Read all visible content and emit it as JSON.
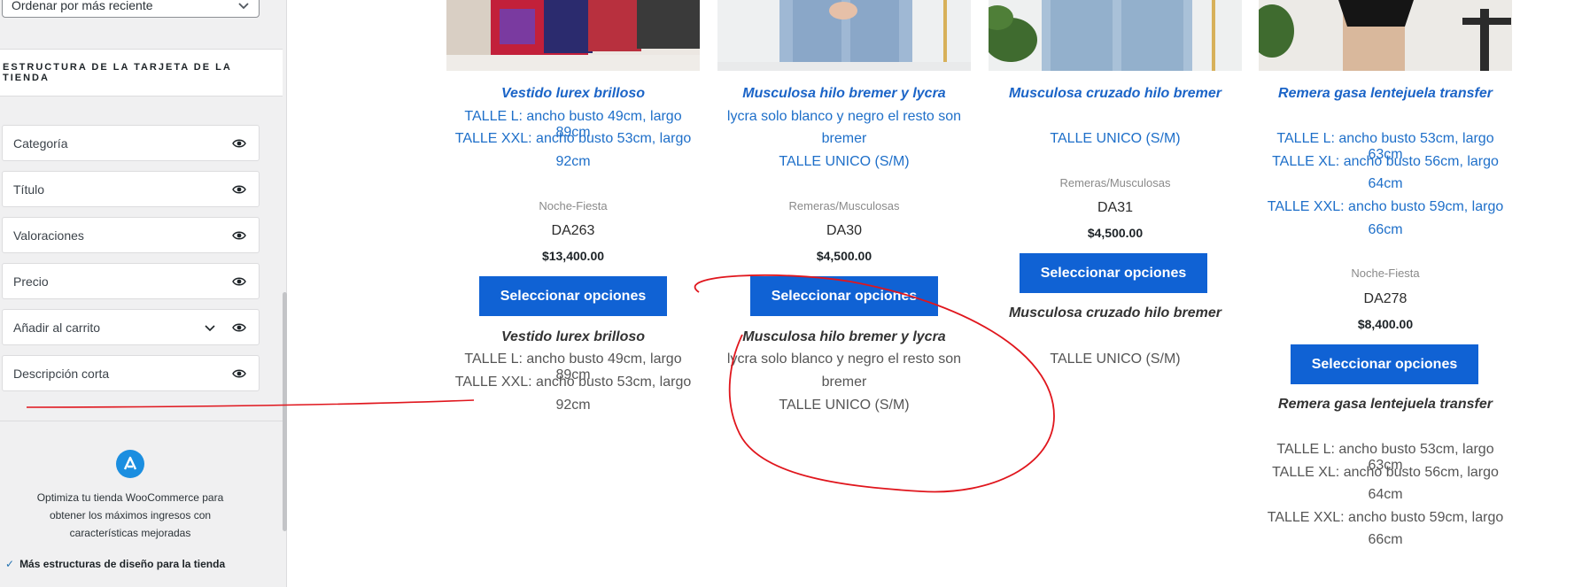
{
  "sidebar": {
    "sort_value": "Ordenar por más reciente",
    "section_title": "Estructura de la tarjeta de la tienda",
    "items": [
      {
        "label": "Categoría"
      },
      {
        "label": "Título"
      },
      {
        "label": "Valoraciones"
      },
      {
        "label": "Precio"
      },
      {
        "label": "Añadir al carrito"
      },
      {
        "label": "Descripción corta"
      }
    ],
    "promo_text": "Optimiza tu tienda WooCommerce para obtener los máximos ingresos con características mejoradas",
    "feature_text": "Más estructuras de diseño para la tienda"
  },
  "products": [
    {
      "title": "Vestido lurex brilloso",
      "desc1": "TALLE L: ancho busto 49cm, largo 89cm",
      "desc2": "TALLE XXL: ancho busto 53cm, largo",
      "desc3": "92cm",
      "category": "Noche-Fiesta",
      "sku": "DA263",
      "price": "$13,400.00",
      "button": "Seleccionar opciones",
      "title2": "Vestido lurex brilloso",
      "b1": "TALLE L: ancho busto 49cm, largo 89cm",
      "b2": "TALLE XXL: ancho busto 53cm, largo",
      "b3": "92cm"
    },
    {
      "title": "Musculosa hilo bremer y lycra",
      "desc1": "lycra solo blanco y negro el resto son",
      "desc2": "bremer",
      "desc3": "TALLE UNICO (S/M)",
      "category": "Remeras/Musculosas",
      "sku": "DA30",
      "price": "$4,500.00",
      "button": "Seleccionar opciones",
      "title2": "Musculosa hilo bremer y lycra",
      "b1": "lycra solo blanco y negro el resto son",
      "b2": "bremer",
      "b3": "TALLE UNICO (S/M)"
    },
    {
      "title": "Musculosa cruzado hilo bremer",
      "desc1": "TALLE UNICO (S/M)",
      "category": "Remeras/Musculosas",
      "sku": "DA31",
      "price": "$4,500.00",
      "button": "Seleccionar opciones",
      "title2": "Musculosa cruzado hilo bremer",
      "b1": "TALLE UNICO (S/M)"
    },
    {
      "title": "Remera gasa lentejuela transfer",
      "desc1": "TALLE L: ancho busto 53cm, largo 63cm",
      "desc2": "TALLE XL: ancho busto 56cm, largo",
      "desc3": "64cm",
      "desc4": "TALLE XXL: ancho busto 59cm, largo",
      "desc5": "66cm",
      "category": "Noche-Fiesta",
      "sku": "DA278",
      "price": "$8,400.00",
      "button": "Seleccionar opciones",
      "title2": "Remera gasa lentejuela transfer",
      "b1": "TALLE L: ancho busto 53cm, largo 63cm",
      "b2": "TALLE XL: ancho busto 56cm, largo",
      "b3": "64cm",
      "b4": "TALLE XXL: ancho busto 59cm, largo",
      "b5": "66cm"
    }
  ],
  "colors": {
    "accent": "#1062d4",
    "link": "#1e6fc9",
    "annotation": "#e0161d"
  }
}
